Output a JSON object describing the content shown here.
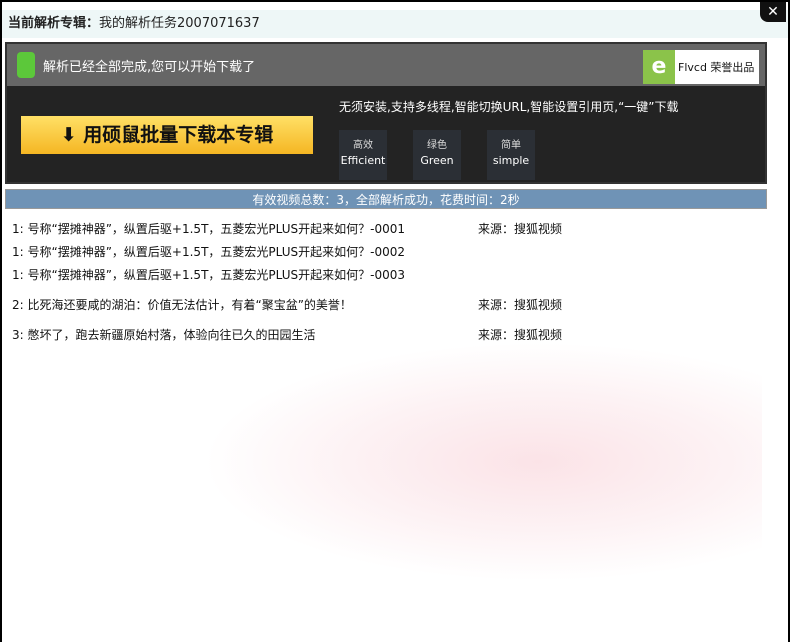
{
  "title": {
    "label": "当前解析专辑：",
    "value": "我的解析任务2007071637"
  },
  "close_label": "✕",
  "banner": {
    "message": "解析已经全部完成,您可以开始下载了",
    "logo_text": "Flvcd 荣誉出品",
    "download_button": "⬇ 用硕鼠批量下载本专辑",
    "features_text": "无须安装,支持多线程,智能切换URL,智能设置引用页,“一键”下载",
    "features": [
      {
        "cn": "高效",
        "en": "Efficient"
      },
      {
        "cn": "绿色",
        "en": "Green"
      },
      {
        "cn": "简单",
        "en": "simple"
      }
    ]
  },
  "summary": "有效视频总数：3，全部解析成功，花费时间：2秒",
  "rows": [
    {
      "text": "1: 号称“摆摊神器”，纵置后驱+1.5T，五菱宏光PLUS开起来如何？-0001",
      "source": "来源：搜狐视频"
    },
    {
      "text": "1: 号称“摆摊神器”，纵置后驱+1.5T，五菱宏光PLUS开起来如何？-0002",
      "source": ""
    },
    {
      "text": "1: 号称“摆摊神器”，纵置后驱+1.5T，五菱宏光PLUS开起来如何？-0003",
      "source": ""
    },
    {
      "text": "2: 比死海还要咸的湖泊：价值无法估计，有着“聚宝盆”的美誉！",
      "source": "来源：搜狐视频"
    },
    {
      "text": "3: 憋坏了，跑去新疆原始村落，体验向往已久的田园生活",
      "source": "来源：搜狐视频"
    }
  ]
}
